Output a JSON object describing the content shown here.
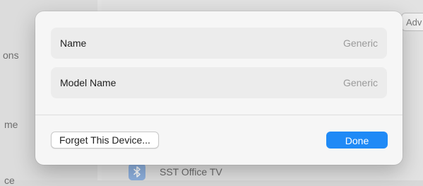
{
  "background": {
    "sidebar_partial_labels": [
      "ons",
      "me",
      "ce"
    ],
    "tab_partial_label": "Adv",
    "device": {
      "icon": "bluetooth-icon",
      "label": "SST Office TV"
    }
  },
  "dialog": {
    "rows": [
      {
        "label": "Name",
        "value": "Generic"
      },
      {
        "label": "Model Name",
        "value": "Generic"
      }
    ],
    "buttons": {
      "forget_label": "Forget This Device...",
      "done_label": "Done"
    }
  },
  "colors": {
    "accent": "#1f8af6",
    "dialog_bg": "#f6f6f6",
    "row_bg": "#ececec"
  }
}
